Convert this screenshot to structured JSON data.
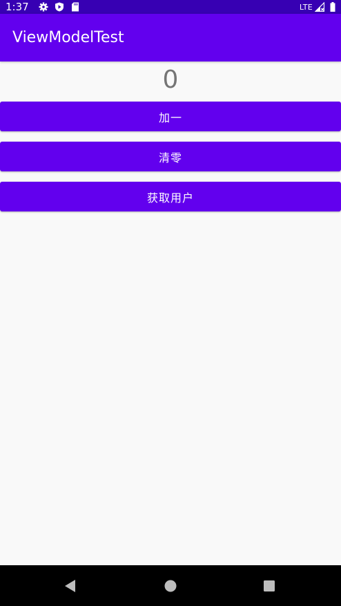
{
  "status_bar": {
    "time": "1:37",
    "network": "LTE",
    "icons": [
      "settings-icon",
      "play-protect-icon",
      "sd-card-icon",
      "signal-icon",
      "battery-icon"
    ]
  },
  "app_bar": {
    "title": "ViewModelTest"
  },
  "main": {
    "counter_value": "0",
    "buttons": [
      {
        "label": "加一"
      },
      {
        "label": "清零"
      },
      {
        "label": "获取用户"
      }
    ]
  },
  "nav_bar": {
    "icons": [
      "back-icon",
      "home-icon",
      "recents-icon"
    ]
  },
  "colors": {
    "status_bar": "#3700b3",
    "primary": "#6200ee",
    "background": "#f9f9f9",
    "counter_text": "#757575"
  }
}
